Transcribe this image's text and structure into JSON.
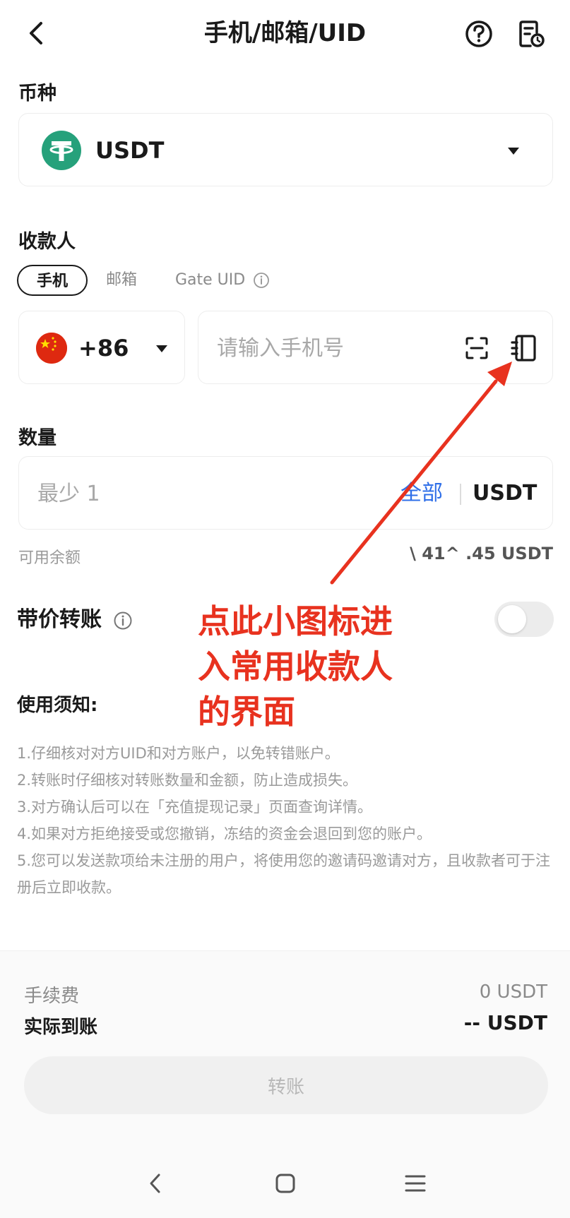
{
  "header": {
    "title": "手机/邮箱/UID",
    "back_icon": "chevron-left-icon",
    "help_icon": "question-circle-icon",
    "record_icon": "transfer-record-icon"
  },
  "currency": {
    "label": "币种",
    "selected": "USDT",
    "logo_color": "#26a17b"
  },
  "recipient": {
    "label": "收款人",
    "tabs": [
      {
        "label": "手机",
        "active": true
      },
      {
        "label": "邮箱",
        "active": false
      },
      {
        "label": "Gate UID",
        "active": false
      }
    ],
    "country_code": "+86",
    "phone_placeholder": "请输入手机号"
  },
  "amount": {
    "label": "数量",
    "placeholder": "最少 1",
    "all_label": "全部",
    "unit": "USDT",
    "balance_label": "可用余额",
    "balance_value": "\\ 41^ .45 USDT"
  },
  "priced_transfer": {
    "label": "带价转账",
    "enabled": false
  },
  "notice": {
    "title": "使用须知:",
    "items": [
      "1.仔细核对对方UID和对方账户，以免转错账户。",
      "2.转账时仔细核对转账数量和金额，防止造成损失。",
      "3.对方确认后可以在「充值提现记录」页面查询详情。",
      "4.如果对方拒绝接受或您撤销，冻结的资金会退回到您的账户。",
      "5.您可以发送款项给未注册的用户，将使用您的邀请码邀请对方，且收款者可于注册后立即收款。"
    ]
  },
  "annotation": {
    "text": "点此小图标进\n入常用收款人\n的界面",
    "color": "#e8321f"
  },
  "summary": {
    "fee_label": "手续费",
    "fee_value": "0 USDT",
    "actual_label": "实际到账",
    "actual_value": "-- USDT",
    "transfer_button": "转账"
  },
  "accent_color": "#2f6fe8"
}
